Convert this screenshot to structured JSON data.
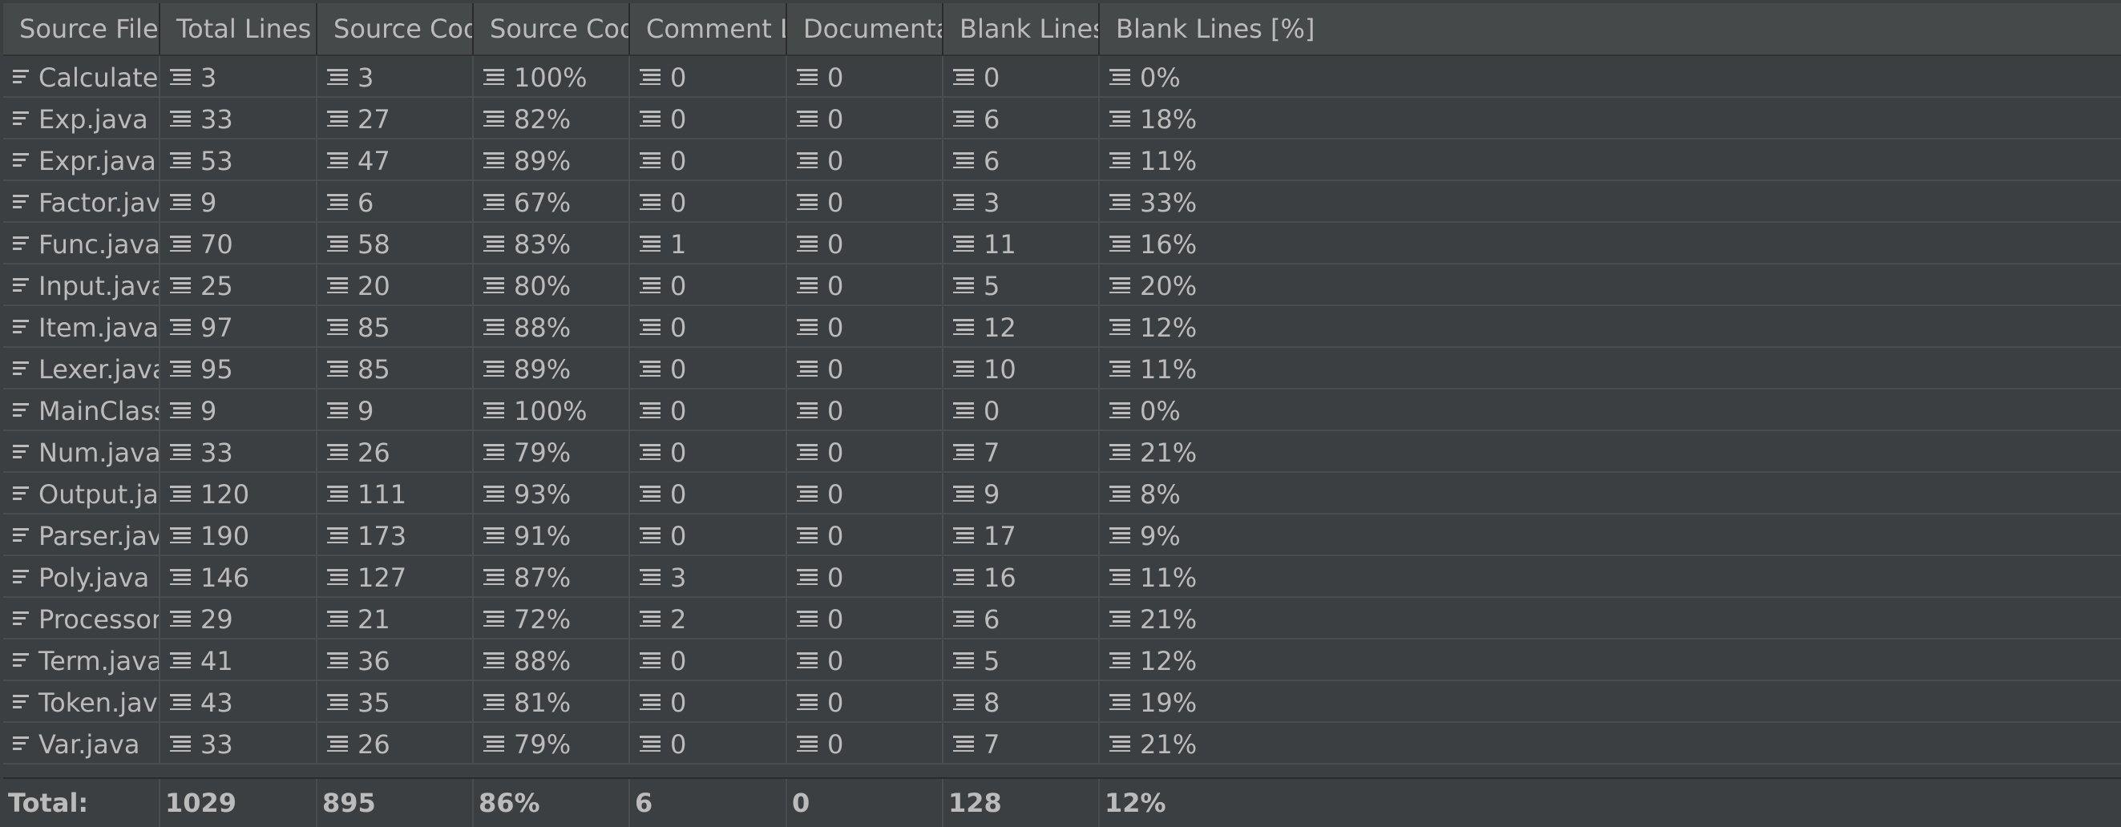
{
  "columns": [
    "Source File",
    "Total Lines",
    "Source Code Li...",
    "Source Code Li...",
    "Comment Lines",
    "Documentation ...",
    "Blank Lines",
    "Blank Lines [%]"
  ],
  "rows": [
    [
      "Calculate.java",
      "3",
      "3",
      "100%",
      "0",
      "0",
      "0",
      "0%"
    ],
    [
      "Exp.java",
      "33",
      "27",
      "82%",
      "0",
      "0",
      "6",
      "18%"
    ],
    [
      "Expr.java",
      "53",
      "47",
      "89%",
      "0",
      "0",
      "6",
      "11%"
    ],
    [
      "Factor.java",
      "9",
      "6",
      "67%",
      "0",
      "0",
      "3",
      "33%"
    ],
    [
      "Func.java",
      "70",
      "58",
      "83%",
      "1",
      "0",
      "11",
      "16%"
    ],
    [
      "Input.java",
      "25",
      "20",
      "80%",
      "0",
      "0",
      "5",
      "20%"
    ],
    [
      "Item.java",
      "97",
      "85",
      "88%",
      "0",
      "0",
      "12",
      "12%"
    ],
    [
      "Lexer.java",
      "95",
      "85",
      "89%",
      "0",
      "0",
      "10",
      "11%"
    ],
    [
      "MainClass.java",
      "9",
      "9",
      "100%",
      "0",
      "0",
      "0",
      "0%"
    ],
    [
      "Num.java",
      "33",
      "26",
      "79%",
      "0",
      "0",
      "7",
      "21%"
    ],
    [
      "Output.java",
      "120",
      "111",
      "93%",
      "0",
      "0",
      "9",
      "8%"
    ],
    [
      "Parser.java",
      "190",
      "173",
      "91%",
      "0",
      "0",
      "17",
      "9%"
    ],
    [
      "Poly.java",
      "146",
      "127",
      "87%",
      "3",
      "0",
      "16",
      "11%"
    ],
    [
      "Processor.java",
      "29",
      "21",
      "72%",
      "2",
      "0",
      "6",
      "21%"
    ],
    [
      "Term.java",
      "41",
      "36",
      "88%",
      "0",
      "0",
      "5",
      "12%"
    ],
    [
      "Token.java",
      "43",
      "35",
      "81%",
      "0",
      "0",
      "8",
      "19%"
    ],
    [
      "Var.java",
      "33",
      "26",
      "79%",
      "0",
      "0",
      "7",
      "21%"
    ]
  ],
  "totals": [
    "Total:",
    "1029",
    "895",
    "86%",
    "6",
    "0",
    "128",
    "12%"
  ],
  "icons": {
    "file": "file-lines-icon",
    "value": "align-lines-icon"
  },
  "colors": {
    "background": "#3c3f41",
    "header": "#45494a",
    "text": "#bbbbbb",
    "grid": "#4a4d4f"
  }
}
